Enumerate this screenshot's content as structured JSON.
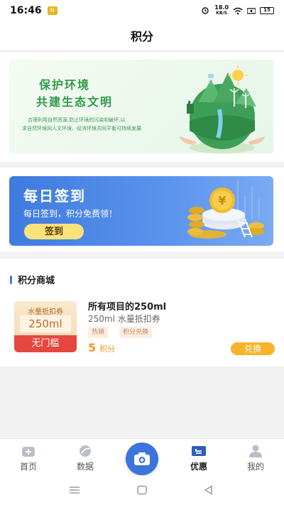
{
  "status_bar": {
    "time": "16:46",
    "app_badge": "N",
    "speed_value": "18.0",
    "speed_unit": "KB/S",
    "battery": "15"
  },
  "header": {
    "title": "积分"
  },
  "banner": {
    "title_line1": "保护环境",
    "title_line2": "共建生态文明",
    "desc_line1": "合理利用自然资源,防止环境的污染和破坏,以",
    "desc_line2": "求自然环境同人文环境、经济环境共同平衡可持续发展"
  },
  "signin": {
    "title": "每日签到",
    "subtitle": "每日签到，积分免费领！",
    "button_label": "签到",
    "coin_symbol": "¥"
  },
  "mall": {
    "title": "积分商城",
    "items": [
      {
        "coupon_top": "水量抵扣券",
        "coupon_amount": "250ml",
        "coupon_bottom": "无门槛",
        "name": "所有项目的250ml",
        "desc": "250ml 水量抵扣券",
        "tags": [
          "热销",
          "积分兑换"
        ],
        "points": "5",
        "points_unit": "积分",
        "button_label": "兑换"
      }
    ]
  },
  "tab_bar": {
    "tabs": [
      {
        "label": "首页",
        "icon": "home-icon"
      },
      {
        "label": "数据",
        "icon": "data-icon"
      },
      {
        "label": "",
        "icon": "camera-icon"
      },
      {
        "label": "优惠",
        "icon": "ticket-icon"
      },
      {
        "label": "我的",
        "icon": "user-icon"
      }
    ],
    "active": "优惠"
  },
  "colors": {
    "accent_blue": "#3a74dc",
    "points_orange": "#f09a1e",
    "coupon_red": "#e5473f",
    "eco_green": "#2f9a48"
  }
}
